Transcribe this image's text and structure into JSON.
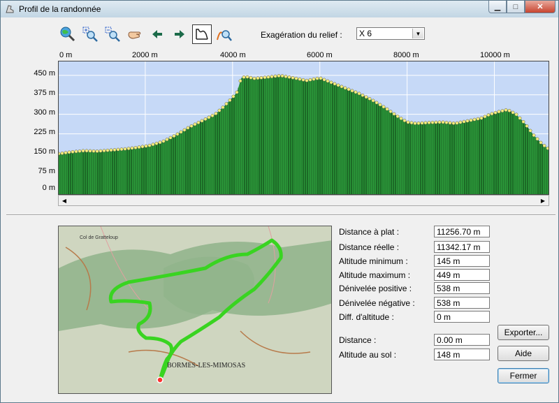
{
  "window": {
    "title": "Profil de la randonnée",
    "controls": {
      "minimize": "▁",
      "maximize": "□",
      "close": "✕"
    }
  },
  "toolbar": {
    "buttons": [
      {
        "name": "zoom-fit-button",
        "icon": "globe-magnifier-icon"
      },
      {
        "name": "zoom-in-button",
        "icon": "zoom-in-icon"
      },
      {
        "name": "zoom-out-button",
        "icon": "zoom-out-icon"
      },
      {
        "name": "pan-button",
        "icon": "hand-icon"
      },
      {
        "name": "back-button",
        "icon": "arrow-left-icon"
      },
      {
        "name": "forward-button",
        "icon": "arrow-right-icon"
      },
      {
        "name": "profile-mode-button",
        "icon": "profile-icon",
        "active": true
      },
      {
        "name": "path-zoom-button",
        "icon": "path-magnifier-icon"
      }
    ],
    "relief_label": "Exagération du relief :",
    "relief_value": "X 6"
  },
  "chart_data": {
    "type": "area",
    "x_ticks": [
      "0 m",
      "2000 m",
      "4000 m",
      "6000 m",
      "8000 m",
      "10000 m"
    ],
    "y_ticks": [
      "450 m",
      "375 m",
      "300 m",
      "225 m",
      "150 m",
      "75 m",
      "0 m"
    ],
    "xlim": [
      0,
      11256.7
    ],
    "ylim": [
      0,
      480
    ],
    "grid": true,
    "series": [
      {
        "x": [
          0,
          300,
          600,
          900,
          1200,
          1500,
          1800,
          2100,
          2400,
          2700,
          3000,
          3300,
          3600,
          3800,
          4000,
          4100,
          4200,
          4300,
          4500,
          4800,
          5100,
          5400,
          5700,
          6000,
          6300,
          6600,
          6900,
          7200,
          7500,
          7800,
          8000,
          8200,
          8500,
          8800,
          9100,
          9400,
          9700,
          9900,
          10100,
          10300,
          10500,
          10700,
          10900,
          11100,
          11256.7
        ],
        "y": [
          148,
          155,
          160,
          158,
          162,
          166,
          172,
          180,
          195,
          220,
          250,
          275,
          300,
          330,
          365,
          385,
          440,
          445,
          438,
          443,
          449,
          440,
          430,
          440,
          420,
          400,
          380,
          355,
          325,
          290,
          270,
          265,
          268,
          270,
          265,
          275,
          285,
          300,
          310,
          318,
          300,
          265,
          220,
          185,
          165
        ]
      }
    ],
    "colors": {
      "sky": "#c6d9f7",
      "terrain": "#2b9a3a",
      "crest": "#f5ef7a",
      "grid": "#ffffff"
    }
  },
  "stats": [
    {
      "label": "Distance à plat :",
      "value": "11256.70 m"
    },
    {
      "label": "Distance réelle :",
      "value": "11342.17 m"
    },
    {
      "label": "Altitude minimum :",
      "value": "145 m"
    },
    {
      "label": "Altitude maximum :",
      "value": "449 m"
    },
    {
      "label": "Dénivelée positive :",
      "value": "538 m"
    },
    {
      "label": "Dénivelée négative :",
      "value": "538 m"
    },
    {
      "label": "Diff. d'altitude :",
      "value": "0 m"
    }
  ],
  "cursor": [
    {
      "label": "Distance :",
      "value": "0.00 m"
    },
    {
      "label": "Altitude au sol :",
      "value": "148 m"
    }
  ],
  "buttons": {
    "export": "Exporter...",
    "help": "Aide",
    "close": "Fermer"
  },
  "map": {
    "labels": [
      "Col de Gratteloup",
      "BORMES-LES-MIMOSAS"
    ],
    "colors": {
      "background": "#cfd6c0",
      "forest": "#8fb38a",
      "track": "#39d421"
    }
  }
}
